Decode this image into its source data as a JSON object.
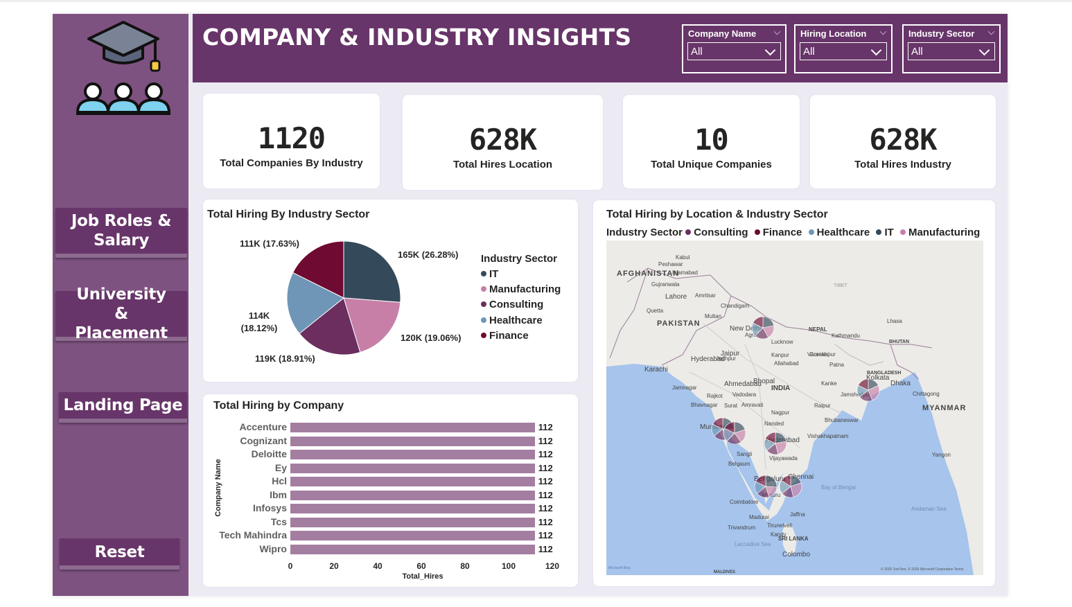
{
  "title": "COMPANY & INDUSTRY INSIGHTS",
  "filters": [
    {
      "label": "Company Name",
      "value": "All"
    },
    {
      "label": "Hiring Location",
      "value": "All"
    },
    {
      "label": "Industry Sector",
      "value": "All"
    }
  ],
  "nav": {
    "job_roles": "Job Roles & Salary",
    "university": "University & Placement",
    "landing": "Landing Page",
    "reset": "Reset"
  },
  "kpis": [
    {
      "value": "1120",
      "label": "Total Companies By Industry"
    },
    {
      "value": "628K",
      "label": "Total Hires Location"
    },
    {
      "value": "10",
      "label": "Total Unique Companies"
    },
    {
      "value": "628K",
      "label": "Total Hires Industry"
    }
  ],
  "colors": {
    "it": "#34495a",
    "manufacturing": "#c77fa7",
    "consulting": "#6b2e5f",
    "healthcare": "#6f96b6",
    "finance": "#6f0a33",
    "bar": "#a47ea1",
    "header": "#673569",
    "sidebar": "#7e5280"
  },
  "pie": {
    "title": "Total Hiring By Industry Sector",
    "legend_title": "Industry Sector",
    "slices": [
      {
        "name": "IT",
        "value": 165,
        "label": "165K (26.28%)",
        "color": "#34495a"
      },
      {
        "name": "Manufacturing",
        "value": 120,
        "label": "120K (19.06%)",
        "color": "#c77fa7"
      },
      {
        "name": "Consulting",
        "value": 119,
        "label": "119K (18.91%)",
        "color": "#6b2e5f"
      },
      {
        "name": "Healthcare",
        "value": 114,
        "label_line1": "114K",
        "label_line2": "(18.12%)",
        "color": "#6f96b6"
      },
      {
        "name": "Finance",
        "value": 111,
        "label": "111K (17.63%)",
        "color": "#6f0a33"
      }
    ],
    "legend": [
      "IT",
      "Manufacturing",
      "Consulting",
      "Healthcare",
      "Finance"
    ]
  },
  "chart_data": {
    "type": "bar",
    "title": "Total Hiring by Company",
    "xlabel": "Total_Hires",
    "ylabel": "Company Name",
    "categories": [
      "Accenture",
      "Cognizant",
      "Deloitte",
      "Ey",
      "Hcl",
      "Ibm",
      "Infosys",
      "Tcs",
      "Tech Mahindra",
      "Wipro"
    ],
    "values": [
      112,
      112,
      112,
      112,
      112,
      112,
      112,
      112,
      112,
      112
    ],
    "xlim": [
      0,
      120
    ],
    "xticks": [
      "0",
      "20",
      "40",
      "60",
      "80",
      "100",
      "120"
    ]
  },
  "map": {
    "title": "Total Hiring by Location & Industry Sector",
    "legend_title": "Industry Sector",
    "legend": [
      "Consulting",
      "Finance",
      "Healthcare",
      "IT",
      "Manufacturing"
    ],
    "country_labels": [
      "AFGHANISTAN",
      "PAKISTAN",
      "INDIA",
      "NEPAL",
      "BHUTAN",
      "BANGLADESH",
      "MYANMAR",
      "SRI LANKA",
      "MALDIVES",
      "TIBET"
    ],
    "city_labels": [
      "Kabul",
      "Peshawar",
      "Islamabad",
      "Gujranwala",
      "Lahore",
      "Amritsar",
      "Chandigarh",
      "Quetta",
      "Multan",
      "New Delhi",
      "Agra",
      "Lucknow",
      "Kathmandu",
      "Lhasa",
      "Karachi",
      "Hyderabad",
      "Jodhpur",
      "Jaipur",
      "Kanpur",
      "Allahabad",
      "Varanasi",
      "Patna",
      "Ahmedabad",
      "Bhopal",
      "Kolkata",
      "Dhaka",
      "Chittagong",
      "Surat",
      "Vadodara",
      "Amravati",
      "Raipur",
      "Nagpur",
      "Bhubaneswar",
      "Mumbai",
      "Nanded",
      "Hyderabad",
      "Vishakhapatnam",
      "Vijayawada",
      "Belgaum",
      "Bengaluru",
      "Chennai",
      "Mysuru",
      "Coimbatore",
      "Madurai",
      "Trivandrum",
      "Colombo",
      "Yangon",
      "Jamnagar",
      "Rajkot",
      "Bhavnagar",
      "Sangli",
      "Jaffna",
      "Tirunelveli",
      "Kandy",
      "Kanke",
      "Jamshedpur",
      "Gorakhpur",
      "Bay of Bengal",
      "Andaman Sea",
      "Laccadive Sea"
    ],
    "attribution_left": "Microsoft Bing",
    "attribution_right": "© 2025 TomTom, © 2025 Microsoft Corporation  Terms"
  }
}
